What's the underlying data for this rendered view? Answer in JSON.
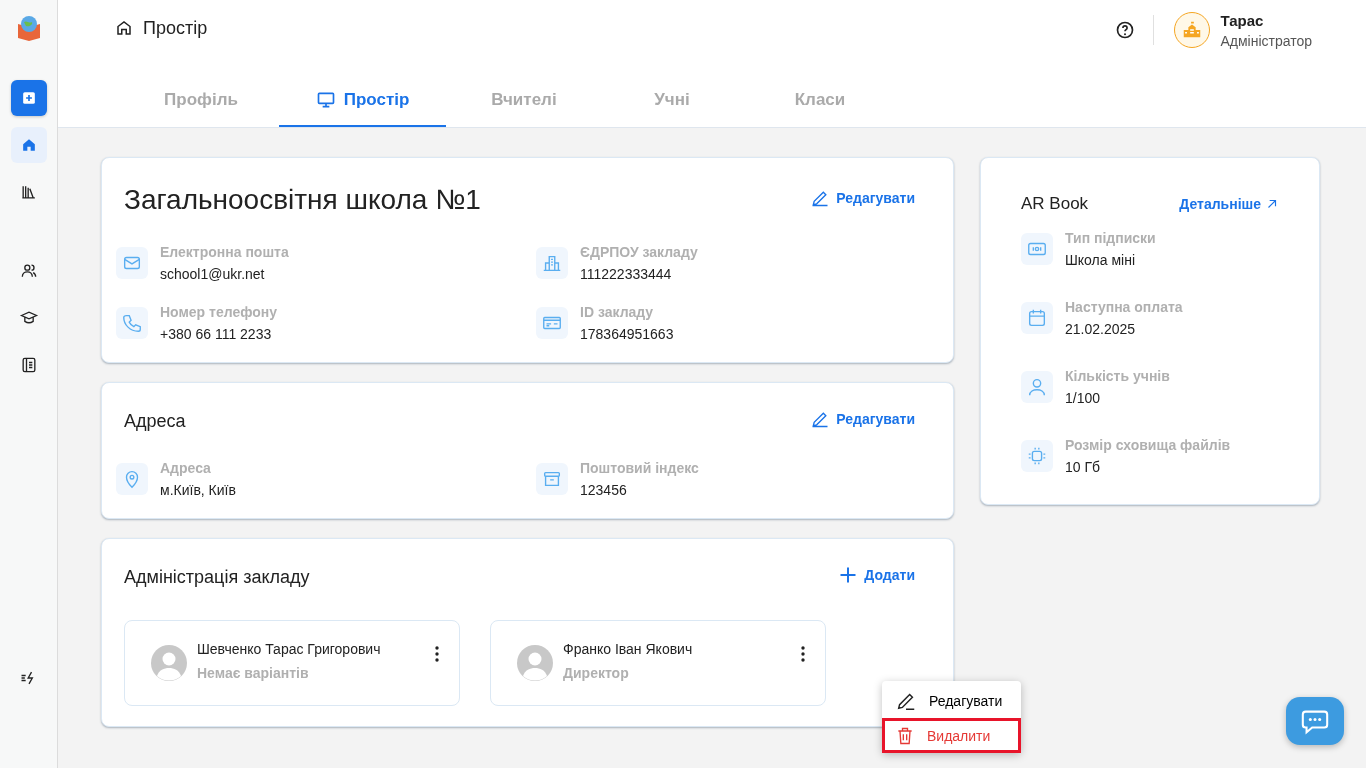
{
  "sidebar": {
    "items": [
      {
        "kind": "add",
        "selected": false
      },
      {
        "kind": "home",
        "selected": true
      },
      {
        "kind": "library",
        "selected": false
      },
      {
        "kind": "people",
        "selected": false
      },
      {
        "kind": "education",
        "selected": false
      },
      {
        "kind": "journal",
        "selected": false
      }
    ],
    "bottom_item": {
      "kind": "flash"
    }
  },
  "breadcrumb": "Простір",
  "user": {
    "name": "Тарас",
    "role": "Адміністратор"
  },
  "tabs": [
    {
      "label": "Профіль",
      "selected": false
    },
    {
      "label": "Простір",
      "selected": true
    },
    {
      "label": "Вчителі",
      "selected": false
    },
    {
      "label": "Учні",
      "selected": false
    },
    {
      "label": "Класи",
      "selected": false
    }
  ],
  "school_card": {
    "title": "Загальноосвітня школа №1",
    "action": "Редагувати",
    "fields": [
      {
        "kind": "email",
        "label": "Електронна пошта",
        "value": "school1@ukr.net"
      },
      {
        "kind": "building",
        "label": "ЄДРПОУ закладу",
        "value": "111222333444"
      },
      {
        "kind": "phone",
        "label": "Номер телефону",
        "value": "+380 66 111 2233"
      },
      {
        "kind": "id",
        "label": "ID закладу",
        "value": "178364951663"
      }
    ]
  },
  "address_card": {
    "title": "Адреса",
    "action": "Редагувати",
    "fields": [
      {
        "kind": "location",
        "label": "Адреса",
        "value": "м.Київ, Київ"
      },
      {
        "kind": "archive",
        "label": "Поштовий індекс",
        "value": "123456"
      }
    ]
  },
  "admin_card": {
    "title": "Адміністрація закладу",
    "action": "Додати",
    "people": [
      {
        "name": "Шевченко Тарас Григорович",
        "role": "Немає варіантів"
      },
      {
        "name": "Франко Іван Якович",
        "role": "Директор"
      }
    ]
  },
  "menu": {
    "items": [
      {
        "kind": "edit",
        "label": "Редагувати",
        "highlighted": false
      },
      {
        "kind": "delete",
        "label": "Видалити",
        "highlighted": true
      }
    ]
  },
  "subscription_card": {
    "title": "AR Book",
    "link": "Детальніше",
    "fields": [
      {
        "kind": "subscription",
        "label": "Тип підписки",
        "value": "Школа міні"
      },
      {
        "kind": "calendar",
        "label": "Наступна оплата",
        "value": "21.02.2025"
      },
      {
        "kind": "person",
        "label": "Кількість учнів",
        "value": "1/100"
      },
      {
        "kind": "storage",
        "label": "Розмір сховища файлів",
        "value": "10 Гб"
      }
    ]
  }
}
